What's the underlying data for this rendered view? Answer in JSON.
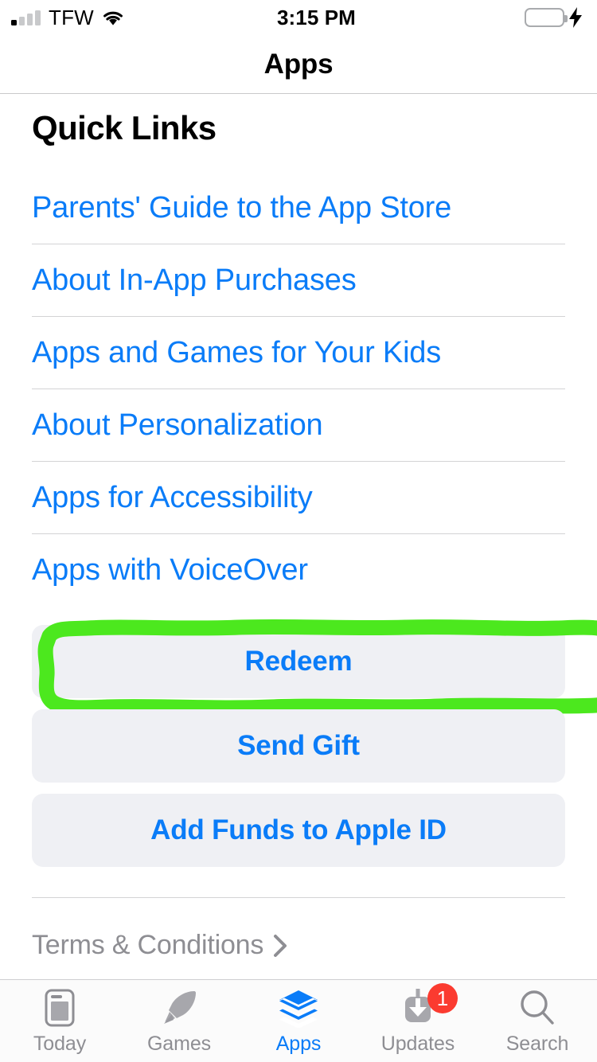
{
  "status_bar": {
    "carrier": "TFW",
    "time": "3:15 PM",
    "wifi_icon": "wifi-icon",
    "signal_icon": "signal-bars-icon",
    "battery_icon": "battery-icon",
    "charging_icon": "lightning-bolt-icon",
    "battery_color": "#3cd653"
  },
  "nav": {
    "title": "Apps"
  },
  "section": {
    "title": "Quick Links"
  },
  "links": [
    {
      "label": "Parents' Guide to the App Store"
    },
    {
      "label": "About In-App Purchases"
    },
    {
      "label": "Apps and Games for Your Kids"
    },
    {
      "label": "About Personalization"
    },
    {
      "label": "Apps for Accessibility"
    },
    {
      "label": "Apps with VoiceOver"
    }
  ],
  "actions": [
    {
      "label": "Redeem",
      "highlighted": true
    },
    {
      "label": "Send Gift",
      "highlighted": false
    },
    {
      "label": "Add Funds to Apple ID",
      "highlighted": false
    }
  ],
  "annotation": {
    "type": "hand-drawn-rectangle",
    "color": "#4ce81e",
    "target": "Redeem"
  },
  "terms": {
    "label": "Terms & Conditions",
    "chevron_icon": "chevron-right-icon"
  },
  "tab_bar": {
    "active": "Apps",
    "accent_color": "#0a7cf8",
    "inactive_color": "#8e8e93",
    "tabs": [
      {
        "label": "Today",
        "icon": "today-card-icon",
        "badge": null
      },
      {
        "label": "Games",
        "icon": "rocket-icon",
        "badge": null
      },
      {
        "label": "Apps",
        "icon": "layers-stack-icon",
        "badge": null
      },
      {
        "label": "Updates",
        "icon": "download-arrow-icon",
        "badge": "1"
      },
      {
        "label": "Search",
        "icon": "magnifier-icon",
        "badge": null
      }
    ]
  }
}
